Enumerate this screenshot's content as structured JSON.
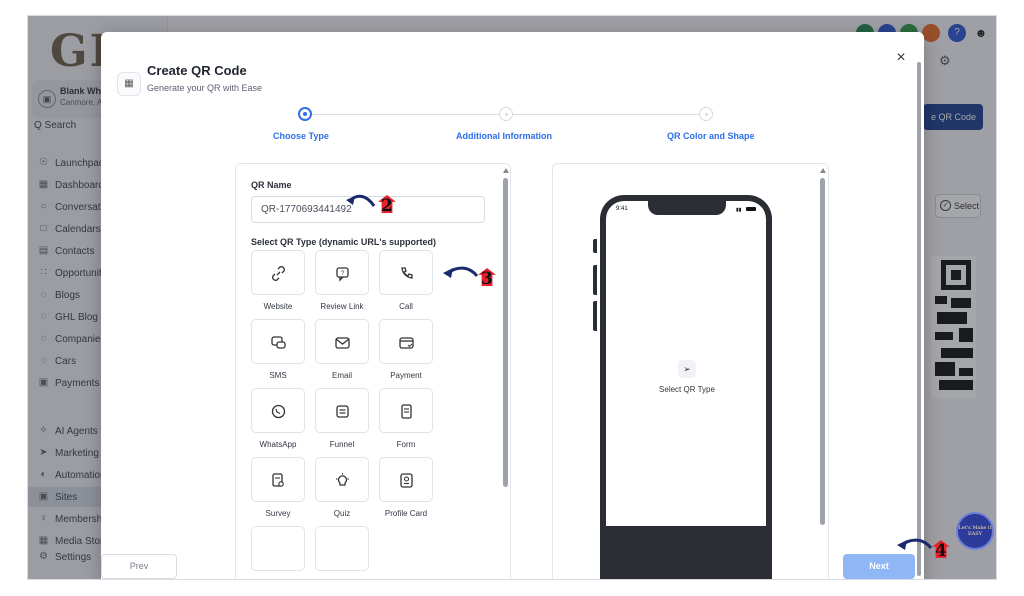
{
  "background": {
    "logo": "GH",
    "account": {
      "name": "Blank WhiteL",
      "location": "Canmore, AB"
    },
    "search": "Q Search",
    "nav": [
      {
        "label": "Launchpad",
        "icon": "rocket-icon"
      },
      {
        "label": "Dashboard",
        "icon": "grid-icon"
      },
      {
        "label": "Conversatio",
        "icon": "chat-icon"
      },
      {
        "label": "Calendars",
        "icon": "calendar-icon"
      },
      {
        "label": "Contacts",
        "icon": "contact-card-icon"
      },
      {
        "label": "Opportuniti",
        "icon": "pipeline-icon"
      },
      {
        "label": "Blogs",
        "icon": "blog-icon"
      },
      {
        "label": "GHL Blog U",
        "icon": "blog-icon"
      },
      {
        "label": "Companies",
        "icon": "building-icon"
      },
      {
        "label": "Cars",
        "icon": "car-icon"
      },
      {
        "label": "Payments",
        "icon": "payment-icon"
      },
      {
        "label": "AI Agents",
        "icon": "sparkle-icon"
      },
      {
        "label": "Marketing",
        "icon": "send-icon"
      },
      {
        "label": "Automation",
        "icon": "automation-icon"
      },
      {
        "label": "Sites",
        "icon": "sites-icon",
        "active": true
      },
      {
        "label": "Membershi",
        "icon": "membership-icon"
      },
      {
        "label": "Media Stora",
        "icon": "media-icon"
      },
      {
        "label": "Settings",
        "icon": "gear-icon"
      }
    ],
    "create_qr_label": "e QR Code",
    "select_label": "Select"
  },
  "modal": {
    "title": "Create QR Code",
    "subtitle": "Generate your QR with Ease",
    "steps": [
      {
        "label": "Choose Type",
        "active": true
      },
      {
        "label": "Additional Information",
        "active": false
      },
      {
        "label": "QR Color and Shape",
        "active": false
      }
    ],
    "qr_name_label": "QR Name",
    "qr_name_value": "QR-1770693441492",
    "qr_type_label": "Select QR Type (dynamic URL's supported)",
    "types": [
      {
        "label": "Website",
        "icon": "link-icon"
      },
      {
        "label": "Review Link",
        "icon": "review-icon"
      },
      {
        "label": "Call",
        "icon": "phone-icon"
      },
      {
        "label": "SMS",
        "icon": "sms-icon"
      },
      {
        "label": "Email",
        "icon": "envelope-icon"
      },
      {
        "label": "Payment",
        "icon": "credit-card-icon"
      },
      {
        "label": "WhatsApp",
        "icon": "whatsapp-icon"
      },
      {
        "label": "Funnel",
        "icon": "funnel-icon"
      },
      {
        "label": "Form",
        "icon": "form-icon"
      },
      {
        "label": "Survey",
        "icon": "survey-icon"
      },
      {
        "label": "Quiz",
        "icon": "lightbulb-icon"
      },
      {
        "label": "Profile Card",
        "icon": "profile-card-icon"
      }
    ],
    "preview": {
      "time": "9:41",
      "text": "Select QR Type"
    },
    "prev_label": "Prev",
    "next_label": "Next"
  },
  "annotations": [
    "2",
    "3",
    "4"
  ],
  "fab_text": "Let's Make it EASY",
  "colors": {
    "accent": "#2f6fe8",
    "next_button": "#8fb6f5",
    "annotation_red": "#e8202a",
    "annotation_arrow": "#1a2a6c"
  }
}
